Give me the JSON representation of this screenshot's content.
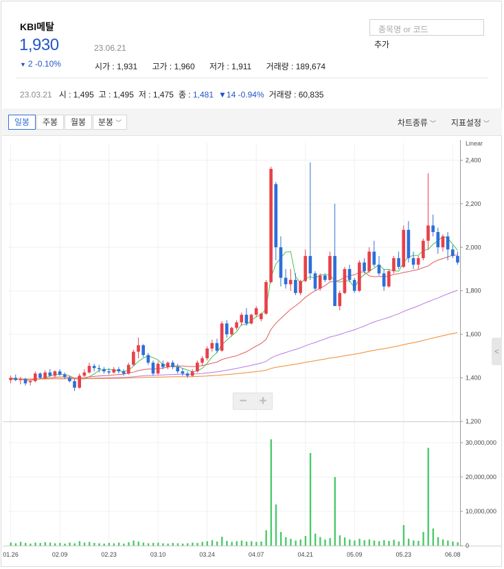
{
  "header": {
    "name": "KBI메탈",
    "price": "1,930",
    "change": "2 -0.10%",
    "date": "23.06.21",
    "stats": [
      {
        "label": "시가",
        "value": "1,931"
      },
      {
        "label": "고가",
        "value": "1,960"
      },
      {
        "label": "저가",
        "value": "1,911"
      },
      {
        "label": "거래량",
        "value": "189,674"
      }
    ]
  },
  "search": {
    "placeholder": "종목명 or 코드",
    "add_label": "추가"
  },
  "prev": {
    "date": "23.03.21",
    "open": "시 : 1,495",
    "high": "고 : 1,495",
    "low": "저 : 1,475",
    "close_label": "종 : ",
    "close_value": "1,481",
    "change": "14 -0.94%",
    "volume": "거래량 : 60,835"
  },
  "toolbar": {
    "tabs": [
      "일봉",
      "주봉",
      "월봉",
      "분봉"
    ],
    "chart_type": "차트종류",
    "indicator": "지표설정"
  },
  "colors": {
    "up": "#e8404a",
    "down": "#2c6fd8",
    "ma5": "#43c150",
    "ma20": "#e05a5a",
    "ma60": "#b777e6",
    "ma120": "#ee8a2a",
    "volume": "#4cc96a"
  },
  "chart_data": {
    "type": "candlestick",
    "scale": "Linear",
    "x_tick_labels": [
      "01.26",
      "02.09",
      "02.23",
      "03.10",
      "03.24",
      "04.07",
      "04.21",
      "05.09",
      "05.23",
      "06.08"
    ],
    "x_tick_index": [
      0,
      10,
      20,
      30,
      40,
      50,
      60,
      70,
      80,
      90
    ],
    "price_axis": {
      "min": 1200,
      "max": 2480,
      "ticks": [
        1200,
        1400,
        1600,
        1800,
        2000,
        2200,
        2400
      ]
    },
    "price_tick_labels": [
      "1,200",
      "1,400",
      "1,600",
      "1,800",
      "2,000",
      "2,200",
      "2,400"
    ],
    "volume_axis": {
      "min": 0,
      "max": 35000000,
      "ticks": [
        0,
        10000000,
        20000000,
        30000000
      ]
    },
    "volume_tick_labels": [
      "0",
      "10,000,000",
      "20,000,000",
      "30,000,000"
    ],
    "ohlc": [
      [
        1390,
        1410,
        1375,
        1400
      ],
      [
        1400,
        1415,
        1385,
        1390
      ],
      [
        1390,
        1405,
        1370,
        1395
      ],
      [
        1395,
        1400,
        1365,
        1375
      ],
      [
        1380,
        1390,
        1365,
        1385
      ],
      [
        1385,
        1430,
        1380,
        1420
      ],
      [
        1420,
        1425,
        1395,
        1400
      ],
      [
        1400,
        1435,
        1395,
        1425
      ],
      [
        1425,
        1440,
        1405,
        1410
      ],
      [
        1410,
        1435,
        1400,
        1430
      ],
      [
        1430,
        1440,
        1410,
        1415
      ],
      [
        1415,
        1425,
        1395,
        1405
      ],
      [
        1400,
        1410,
        1380,
        1385
      ],
      [
        1385,
        1395,
        1340,
        1355
      ],
      [
        1355,
        1420,
        1350,
        1410
      ],
      [
        1410,
        1440,
        1405,
        1425
      ],
      [
        1425,
        1470,
        1420,
        1455
      ],
      [
        1455,
        1465,
        1430,
        1445
      ],
      [
        1445,
        1460,
        1425,
        1440
      ],
      [
        1440,
        1450,
        1420,
        1430
      ],
      [
        1430,
        1445,
        1415,
        1425
      ],
      [
        1425,
        1450,
        1420,
        1440
      ],
      [
        1440,
        1450,
        1420,
        1430
      ],
      [
        1430,
        1440,
        1410,
        1420
      ],
      [
        1420,
        1470,
        1415,
        1460
      ],
      [
        1460,
        1530,
        1455,
        1520
      ],
      [
        1520,
        1585,
        1490,
        1550
      ],
      [
        1550,
        1555,
        1495,
        1505
      ],
      [
        1505,
        1515,
        1460,
        1470
      ],
      [
        1470,
        1480,
        1410,
        1420
      ],
      [
        1420,
        1475,
        1415,
        1465
      ],
      [
        1465,
        1480,
        1440,
        1450
      ],
      [
        1450,
        1475,
        1440,
        1470
      ],
      [
        1470,
        1480,
        1440,
        1450
      ],
      [
        1450,
        1465,
        1420,
        1430
      ],
      [
        1430,
        1445,
        1410,
        1420
      ],
      [
        1420,
        1430,
        1400,
        1410
      ],
      [
        1410,
        1440,
        1405,
        1430
      ],
      [
        1430,
        1480,
        1425,
        1470
      ],
      [
        1470,
        1500,
        1455,
        1490
      ],
      [
        1490,
        1545,
        1480,
        1535
      ],
      [
        1535,
        1575,
        1520,
        1560
      ],
      [
        1560,
        1580,
        1515,
        1525
      ],
      [
        1525,
        1660,
        1520,
        1650
      ],
      [
        1650,
        1665,
        1585,
        1600
      ],
      [
        1600,
        1635,
        1590,
        1630
      ],
      [
        1630,
        1665,
        1620,
        1655
      ],
      [
        1655,
        1700,
        1640,
        1690
      ],
      [
        1690,
        1720,
        1640,
        1650
      ],
      [
        1650,
        1695,
        1645,
        1690
      ],
      [
        1690,
        1730,
        1680,
        1720
      ],
      [
        1670,
        1700,
        1660,
        1695
      ],
      [
        1695,
        1850,
        1690,
        1840
      ],
      [
        1840,
        2370,
        1835,
        2360
      ],
      [
        2290,
        2300,
        1940,
        2000
      ],
      [
        2000,
        2050,
        1820,
        1860
      ],
      [
        1860,
        1900,
        1810,
        1830
      ],
      [
        1830,
        1900,
        1800,
        1850
      ],
      [
        1850,
        1880,
        1780,
        1790
      ],
      [
        1790,
        1850,
        1780,
        1845
      ],
      [
        1845,
        1990,
        1840,
        1960
      ],
      [
        1960,
        2390,
        1850,
        1880
      ],
      [
        1880,
        1890,
        1800,
        1810
      ],
      [
        1810,
        1880,
        1800,
        1870
      ],
      [
        1870,
        1880,
        1840,
        1850
      ],
      [
        1850,
        1980,
        1845,
        1960
      ],
      [
        1960,
        2200,
        1780,
        1730
      ],
      [
        1730,
        1800,
        1710,
        1790
      ],
      [
        1790,
        1910,
        1785,
        1900
      ],
      [
        1900,
        1920,
        1840,
        1850
      ],
      [
        1850,
        1860,
        1790,
        1800
      ],
      [
        1800,
        1940,
        1795,
        1930
      ],
      [
        1930,
        1950,
        1880,
        1890
      ],
      [
        1890,
        2000,
        1880,
        1980
      ],
      [
        1980,
        2030,
        1910,
        1920
      ],
      [
        1920,
        1960,
        1870,
        1880
      ],
      [
        1880,
        1900,
        1800,
        1820
      ],
      [
        1820,
        1900,
        1815,
        1890
      ],
      [
        1890,
        1960,
        1880,
        1950
      ],
      [
        1950,
        1980,
        1900,
        1910
      ],
      [
        1910,
        2100,
        1905,
        2080
      ],
      [
        2080,
        2120,
        1930,
        1950
      ],
      [
        1950,
        1980,
        1900,
        1920
      ],
      [
        1920,
        1960,
        1900,
        1950
      ],
      [
        1950,
        2040,
        1940,
        2030
      ],
      [
        2030,
        2340,
        1990,
        2100
      ],
      [
        2100,
        2150,
        2050,
        2070
      ],
      [
        2070,
        2090,
        1970,
        2000
      ],
      [
        2000,
        2060,
        1980,
        2050
      ],
      [
        2050,
        2070,
        1940,
        1990
      ],
      [
        1990,
        2010,
        1950,
        1960
      ],
      [
        1960,
        1980,
        1920,
        1930
      ]
    ],
    "volume": [
      900000,
      700000,
      1100000,
      800000,
      600000,
      900000,
      800000,
      1000000,
      900000,
      700000,
      800000,
      600000,
      900000,
      700000,
      1300000,
      900000,
      1100000,
      800000,
      700000,
      600000,
      800000,
      700000,
      900000,
      600000,
      1000000,
      1500000,
      1200000,
      900000,
      700000,
      800000,
      900000,
      700000,
      600000,
      800000,
      700000,
      600000,
      700000,
      900000,
      800000,
      1100000,
      1300000,
      1600000,
      1200000,
      2600000,
      1400000,
      1100000,
      1300000,
      1500000,
      1200000,
      1300000,
      1100000,
      1200000,
      4500000,
      31000000,
      12000000,
      4000000,
      2500000,
      2000000,
      1500000,
      1800000,
      2800000,
      27000000,
      3500000,
      2500000,
      1800000,
      2200000,
      20000000,
      3000000,
      2400000,
      1800000,
      1500000,
      2000000,
      1600000,
      1800000,
      1500000,
      1300000,
      1600000,
      1400000,
      1700000,
      1200000,
      6000000,
      2000000,
      1500000,
      1400000,
      4000000,
      28500000,
      5000000,
      2500000,
      1800000,
      1500000,
      1200000,
      1000000
    ]
  }
}
